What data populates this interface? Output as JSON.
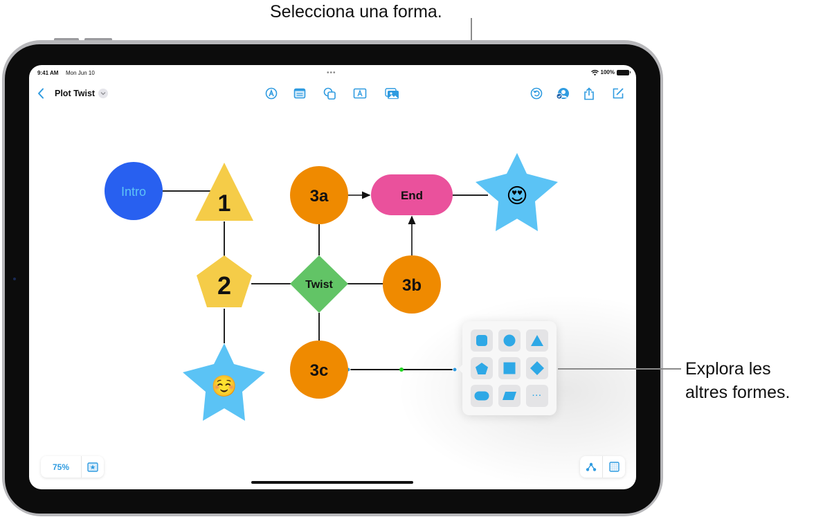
{
  "callouts": {
    "top": "Selecciona una forma.",
    "right_line1": "Explora les",
    "right_line2": "altres formes."
  },
  "status_bar": {
    "time": "9:41 AM",
    "date": "Mon Jun 10",
    "multitask_dots": "•••",
    "battery": "100%"
  },
  "toolbar": {
    "back_icon": "chevron-left-icon",
    "title": "Plot Twist",
    "title_menu_icon": "chevron-down-icon",
    "center_tools": [
      {
        "name": "pen-tool",
        "icon": "pen-nib-icon"
      },
      {
        "name": "sticky-note",
        "icon": "note-icon"
      },
      {
        "name": "shapes",
        "icon": "shapes-icon"
      },
      {
        "name": "text-box",
        "icon": "textbox-icon"
      },
      {
        "name": "media",
        "icon": "photo-icon"
      }
    ],
    "right_tools": [
      {
        "name": "undo-history",
        "icon": "undo-circle-icon"
      },
      {
        "name": "collaborate",
        "icon": "person-check-icon"
      },
      {
        "name": "share",
        "icon": "share-icon"
      },
      {
        "name": "new-board",
        "icon": "compose-icon"
      }
    ]
  },
  "accent_color": "#2f9be0",
  "board": {
    "nodes": [
      {
        "id": "intro",
        "label": "Intro",
        "shape": "circle",
        "fill": "#2860f0",
        "text_color": "#5ec4f5"
      },
      {
        "id": "n1",
        "label": "1",
        "shape": "triangle",
        "fill": "#f5cc48",
        "text_color": "#111111"
      },
      {
        "id": "n2",
        "label": "2",
        "shape": "pentagon",
        "fill": "#f5cc48",
        "text_color": "#111111"
      },
      {
        "id": "star-smile",
        "label": "☺️",
        "shape": "star",
        "fill": "#5bc3f5"
      },
      {
        "id": "n3a",
        "label": "3a",
        "shape": "circle",
        "fill": "#ef8a00",
        "text_color": "#111111"
      },
      {
        "id": "twist",
        "label": "Twist",
        "shape": "diamond",
        "fill": "#62c466",
        "text_color": "#111111"
      },
      {
        "id": "n3c",
        "label": "3c",
        "shape": "circle",
        "fill": "#ef8a00",
        "text_color": "#111111"
      },
      {
        "id": "end",
        "label": "End",
        "shape": "rounded-rect",
        "fill": "#ea519c",
        "text_color": "#111111"
      },
      {
        "id": "n3b",
        "label": "3b",
        "shape": "circle",
        "fill": "#ef8a00",
        "text_color": "#111111"
      },
      {
        "id": "star-love",
        "label": "😍",
        "shape": "star",
        "fill": "#5bc3f5"
      }
    ],
    "connections": [
      {
        "from": "intro",
        "to": "n1",
        "arrow": false
      },
      {
        "from": "n1",
        "to": "n2",
        "arrow": false
      },
      {
        "from": "n2",
        "to": "star-smile",
        "arrow": false
      },
      {
        "from": "n2",
        "to": "twist",
        "arrow": false
      },
      {
        "from": "twist",
        "to": "n3a",
        "arrow": false
      },
      {
        "from": "twist",
        "to": "n3b",
        "arrow": false
      },
      {
        "from": "twist",
        "to": "n3c",
        "arrow": false
      },
      {
        "from": "n3a",
        "to": "end",
        "arrow": true
      },
      {
        "from": "n3b",
        "to": "end",
        "arrow": true
      },
      {
        "from": "end",
        "to": "star-love",
        "arrow": false
      },
      {
        "from": "n3c",
        "to": "(new)",
        "arrow": false,
        "selected": true
      }
    ]
  },
  "shape_picker": {
    "shapes": [
      {
        "name": "rounded-square",
        "icon": "rounded-square-icon"
      },
      {
        "name": "circle",
        "icon": "circle-icon"
      },
      {
        "name": "triangle",
        "icon": "triangle-icon"
      },
      {
        "name": "pentagon",
        "icon": "pentagon-icon"
      },
      {
        "name": "square",
        "icon": "square-icon"
      },
      {
        "name": "diamond",
        "icon": "diamond-icon"
      },
      {
        "name": "capsule",
        "icon": "capsule-icon"
      },
      {
        "name": "parallelogram",
        "icon": "parallelogram-icon"
      },
      {
        "name": "more",
        "icon": "ellipsis-icon",
        "label": "···"
      }
    ]
  },
  "bottom_left": {
    "zoom": "75%",
    "favorites_icon": "star-box-icon"
  },
  "bottom_right": {
    "connection_icon": "connection-nodes-icon",
    "grid_icon": "grid-icon"
  }
}
